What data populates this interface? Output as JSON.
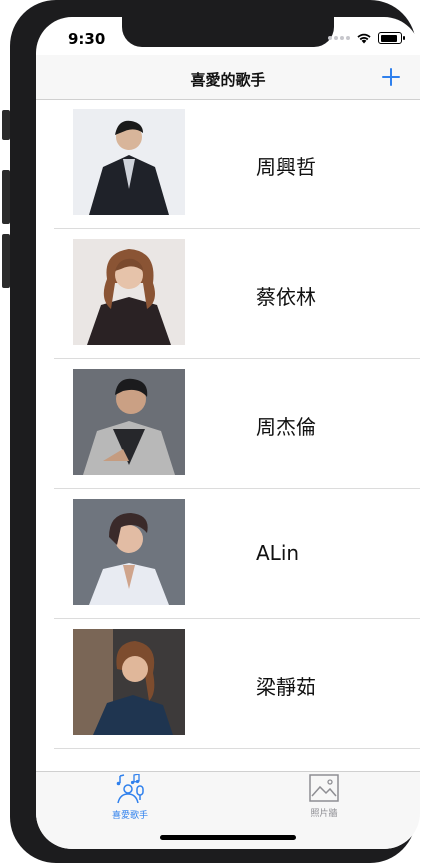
{
  "status": {
    "time": "9:30"
  },
  "navbar": {
    "title": "喜愛的歌手"
  },
  "singers": [
    {
      "name": "周興哲",
      "photo": "singer-photo"
    },
    {
      "name": "蔡依林",
      "photo": "singer-photo"
    },
    {
      "name": "周杰倫",
      "photo": "singer-photo"
    },
    {
      "name": "ALin",
      "photo": "singer-photo"
    },
    {
      "name": "梁靜茹",
      "photo": "singer-photo"
    }
  ],
  "tabs": [
    {
      "label": "喜愛歌手",
      "icon": "singer-icon",
      "selected": true
    },
    {
      "label": "照片牆",
      "icon": "photo-wall-icon",
      "selected": false
    }
  ],
  "colors": {
    "accent": "#2f80ed",
    "inactive": "#8e8e93"
  }
}
